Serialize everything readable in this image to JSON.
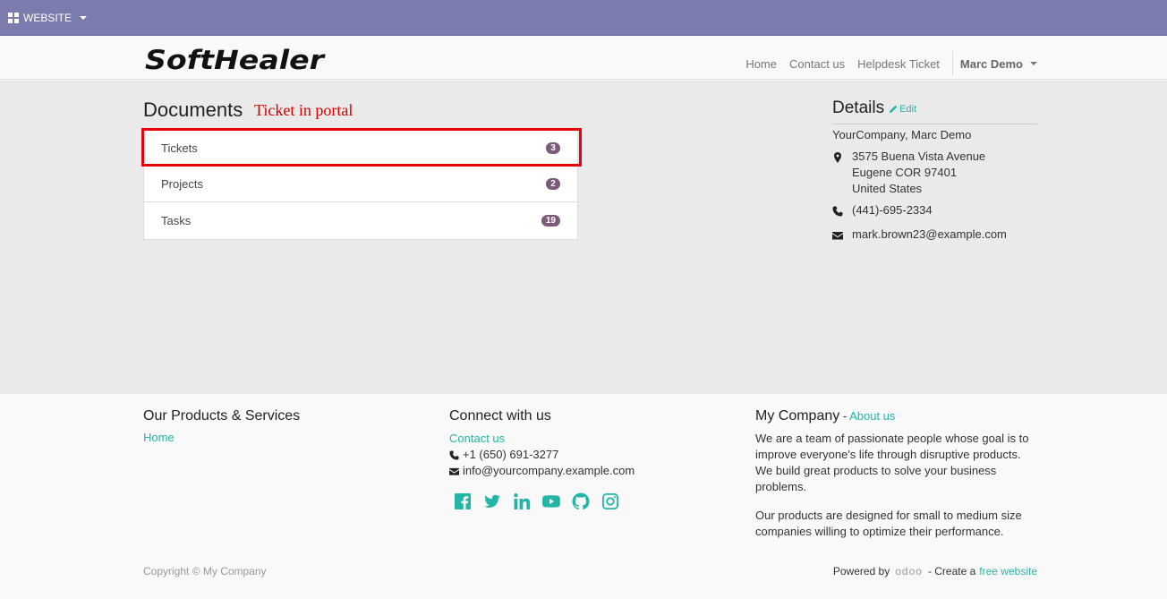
{
  "adminbar": {
    "menu_label": "WEBSITE"
  },
  "navbar": {
    "logo_text": "SoftHealer",
    "links": [
      "Home",
      "Contact us",
      "Helpdesk Ticket"
    ],
    "user": "Marc Demo"
  },
  "documents": {
    "title": "Documents",
    "annotation": "Ticket in portal",
    "items": [
      {
        "label": "Tickets",
        "count": "3"
      },
      {
        "label": "Projects",
        "count": "2"
      },
      {
        "label": "Tasks",
        "count": "19"
      }
    ]
  },
  "details": {
    "title": "Details",
    "edit_label": "Edit",
    "company": "YourCompany, Marc Demo",
    "address": [
      "3575 Buena Vista Avenue",
      "Eugene COR 97401",
      "United States"
    ],
    "phone": "(441)-695-2334",
    "email": "mark.brown23@example.com"
  },
  "footer": {
    "products": {
      "title": "Our Products & Services",
      "home": "Home"
    },
    "connect": {
      "title": "Connect with us",
      "contact": "Contact us",
      "phone": "+1 (650) 691-3277",
      "email": "info@yourcompany.example.com",
      "social_icons": [
        "facebook-icon",
        "twitter-icon",
        "linkedin-icon",
        "youtube-icon",
        "github-icon",
        "instagram-icon"
      ]
    },
    "company": {
      "title": "My Company",
      "separator": " - ",
      "about_link": "About us",
      "p1": "We are a team of passionate people whose goal is to improve everyone's life through disruptive products. We build great products to solve your business problems.",
      "p2": "Our products are designed for small to medium size companies willing to optimize their performance."
    },
    "copyright": "Copyright © My Company",
    "powered_by": "Powered by",
    "odoo": "odoo",
    "create_text": "- Create a",
    "free_website": "free website"
  },
  "colors": {
    "adminbar": "#7c7bad",
    "accent": "#21b6a8",
    "badge": "#7e5a7a",
    "highlight": "#e8000b"
  }
}
